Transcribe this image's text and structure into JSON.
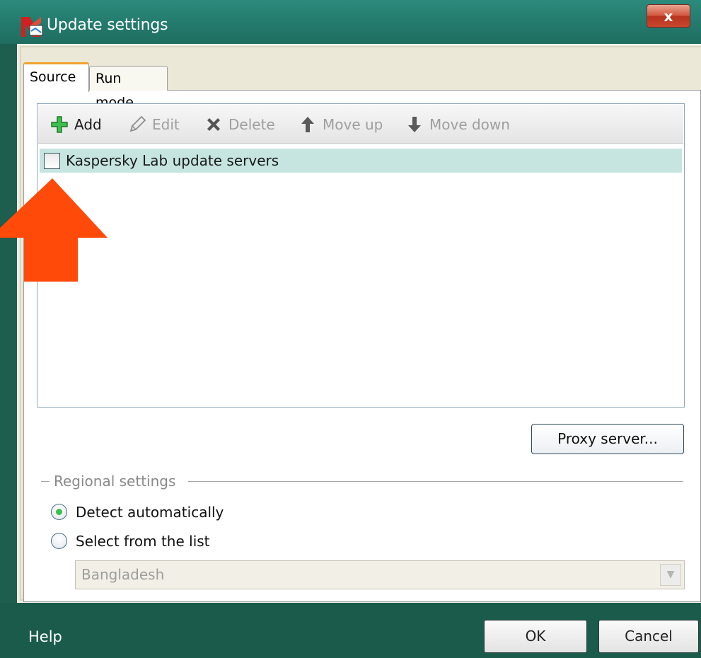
{
  "window": {
    "title": "Update settings",
    "close_label": "x",
    "icon": "kaspersky-logo-icon"
  },
  "tabs": [
    {
      "label": "Source",
      "selected": true
    },
    {
      "label": "Run mode",
      "selected": false
    }
  ],
  "toolbar": {
    "items": [
      {
        "label": "Add",
        "icon": "add-icon",
        "enabled": true
      },
      {
        "label": "Edit",
        "icon": "edit-icon",
        "enabled": false
      },
      {
        "label": "Delete",
        "icon": "delete-icon",
        "enabled": false
      },
      {
        "label": "Move up",
        "icon": "move-up-icon",
        "enabled": false
      },
      {
        "label": "Move down",
        "icon": "move-down-icon",
        "enabled": false
      }
    ]
  },
  "sources": [
    {
      "label": "Kaspersky Lab update servers",
      "checked": false
    }
  ],
  "proxy_button": "Proxy server...",
  "regional": {
    "title": "Regional settings",
    "options": [
      {
        "label": "Detect automatically",
        "selected": true
      },
      {
        "label": "Select from the list",
        "selected": false
      }
    ],
    "select_value": "Bangladesh"
  },
  "footer": {
    "help": "Help",
    "ok": "OK",
    "cancel": "Cancel"
  },
  "colors": {
    "titlebar": "#237a6c",
    "footer": "#1a5b4b",
    "row_highlight": "#c6e5e1",
    "arrow": "#ff4a0a",
    "tab_accent": "#f0a12c"
  }
}
